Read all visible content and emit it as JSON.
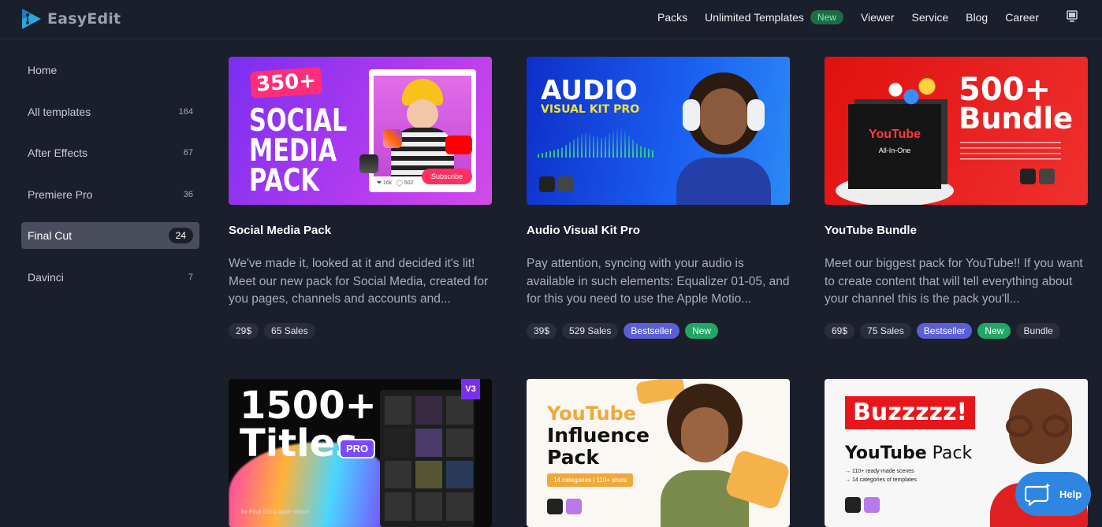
{
  "brand": {
    "name": "EasyEdit",
    "accent": "#2aa8e0"
  },
  "nav": {
    "items": [
      "Packs",
      "Unlimited Templates",
      "Viewer",
      "Service",
      "Blog",
      "Career"
    ],
    "new_badge": "New",
    "device_icon": "monitor-icon"
  },
  "sidebar": {
    "items": [
      {
        "label": "Home",
        "count": ""
      },
      {
        "label": "All templates",
        "count": "164"
      },
      {
        "label": "After Effects",
        "count": "67"
      },
      {
        "label": "Premiere Pro",
        "count": "36"
      },
      {
        "label": "Final Cut",
        "count": "24",
        "active": true
      },
      {
        "label": "Davinci",
        "count": "7"
      }
    ]
  },
  "cards": [
    {
      "title": "Social Media Pack",
      "desc": "We've made it, looked at it and decided it's lit! Meet our new pack for Social Media, created for you pages, channels and accounts and...",
      "tags": [
        {
          "t": "29$",
          "k": ""
        },
        {
          "t": "65 Sales",
          "k": ""
        }
      ],
      "thumb": {
        "badge": "350+",
        "l1": "SOCIAL",
        "l2": "MEDIA",
        "l3": "PACK",
        "subscribe": "Subscribe",
        "likes": "16k",
        "comments": "502"
      }
    },
    {
      "title": "Audio Visual Kit Pro",
      "desc": "Pay attention, syncing with your audio is available in such elements: Equalizer 01-05, and for this you need to use the Apple Motio...",
      "tags": [
        {
          "t": "39$",
          "k": ""
        },
        {
          "t": "529 Sales",
          "k": ""
        },
        {
          "t": "Bestseller",
          "k": "best"
        },
        {
          "t": "New",
          "k": "new"
        }
      ],
      "thumb": {
        "l1": "AUDIO",
        "l2": "VISUAL KIT PRO"
      }
    },
    {
      "title": "YouTube Bundle",
      "desc": "Meet our biggest pack for YouTube!! If you want to create content that will tell everything about your channel this is the pack you'll...",
      "tags": [
        {
          "t": "69$",
          "k": ""
        },
        {
          "t": "75 Sales",
          "k": ""
        },
        {
          "t": "Bestseller",
          "k": "best"
        },
        {
          "t": "New",
          "k": "new"
        },
        {
          "t": "Bundle",
          "k": ""
        }
      ],
      "thumb": {
        "l1": "500+",
        "l2": "Bundle",
        "box1": "YouTube",
        "box2": "All-In-One"
      }
    },
    {
      "title": "",
      "desc": "",
      "tags": [],
      "thumb": {
        "l1": "1500+",
        "l2": "Titles",
        "pro": "PRO",
        "v": "V3",
        "foot": "for Final Cut & Apple Motion"
      }
    },
    {
      "title": "",
      "desc": "",
      "tags": [],
      "thumb": {
        "l1": "YouTube",
        "l2": "Influence",
        "l3": "Pack",
        "chip": "14 categories  |  110+ shots"
      }
    },
    {
      "title": "",
      "desc": "",
      "tags": [],
      "thumb": {
        "l1": "Buzzzzz!",
        "l2": "YouTube",
        "l3": "Pack",
        "s1": "110+ ready-made scenes",
        "s2": "14 categories of templates"
      }
    }
  ],
  "help": {
    "label": "Help",
    "icon": "chat-icon"
  }
}
